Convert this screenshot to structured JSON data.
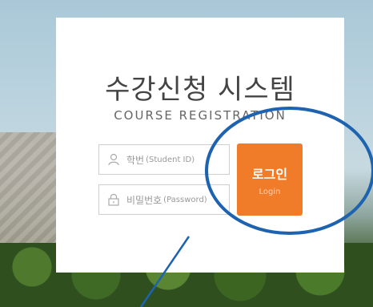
{
  "header": {
    "title": "수강신청 시스템",
    "subtitle": "COURSE REGISTRATION"
  },
  "form": {
    "student_id": {
      "label": "학번",
      "label_en": "Student ID"
    },
    "password": {
      "label": "비밀번호",
      "label_en": "Password"
    }
  },
  "login_button": {
    "label": "로그인",
    "sublabel": "Login",
    "color": "#f07c2a"
  },
  "icons": {
    "user": "user-icon",
    "lock": "lock-icon"
  },
  "annotation_color": "#1e63b0"
}
